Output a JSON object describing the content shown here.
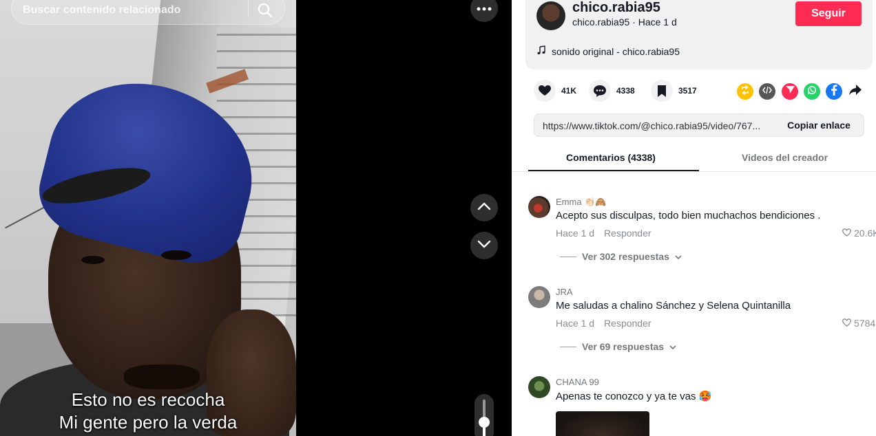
{
  "search": {
    "placeholder": "Buscar contenido relacionado"
  },
  "video": {
    "caption_line_1": "Esto no es recocha",
    "caption_line_2": "Mi gente pero la verda",
    "volume_level": 0.45
  },
  "author": {
    "display_name": "chico.rabia95",
    "username": "chico.rabia95",
    "time_ago": "Hace 1 d",
    "follow_label": "Seguir",
    "sound": "sonido original - chico.rabia95"
  },
  "stats": {
    "likes": "41K",
    "comments": "4338",
    "saves": "3517"
  },
  "link": {
    "url": "https://www.tiktok.com/@chico.rabia95/video/767...",
    "copy_label": "Copiar enlace"
  },
  "tabs": {
    "comments": "Comentarios (4338)",
    "creator_videos": "Videos del creador"
  },
  "comments": [
    {
      "user": "Emma 👏🏻🙈",
      "text": "Acepto sus disculpas, todo bien muchachos bendiciones .",
      "time": "Hace 1 d",
      "reply_label": "Responder",
      "likes": "20.6K",
      "view_replies": "Ver 302 respuestas"
    },
    {
      "user": "JRA",
      "text": "Me saludas a chalino Sánchez y Selena Quintanilla",
      "time": "Hace 1 d",
      "reply_label": "Responder",
      "likes": "5784",
      "view_replies": "Ver 69 respuestas"
    },
    {
      "user": "CHANA 99",
      "text": "Apenas te conozco y ya te vas 🥵"
    }
  ],
  "colors": {
    "accent": "#fe2c55",
    "panel_bg": "#f1f1f2",
    "text": "#161823",
    "muted": "#75767b"
  },
  "icons": [
    "search-icon",
    "more-icon",
    "chevron-up-icon",
    "chevron-down-icon",
    "music-note-icon",
    "heart-icon",
    "comment-icon",
    "bookmark-icon",
    "repost-icon",
    "embed-icon",
    "send-icon",
    "whatsapp-icon",
    "facebook-icon",
    "share-arrow-icon"
  ]
}
